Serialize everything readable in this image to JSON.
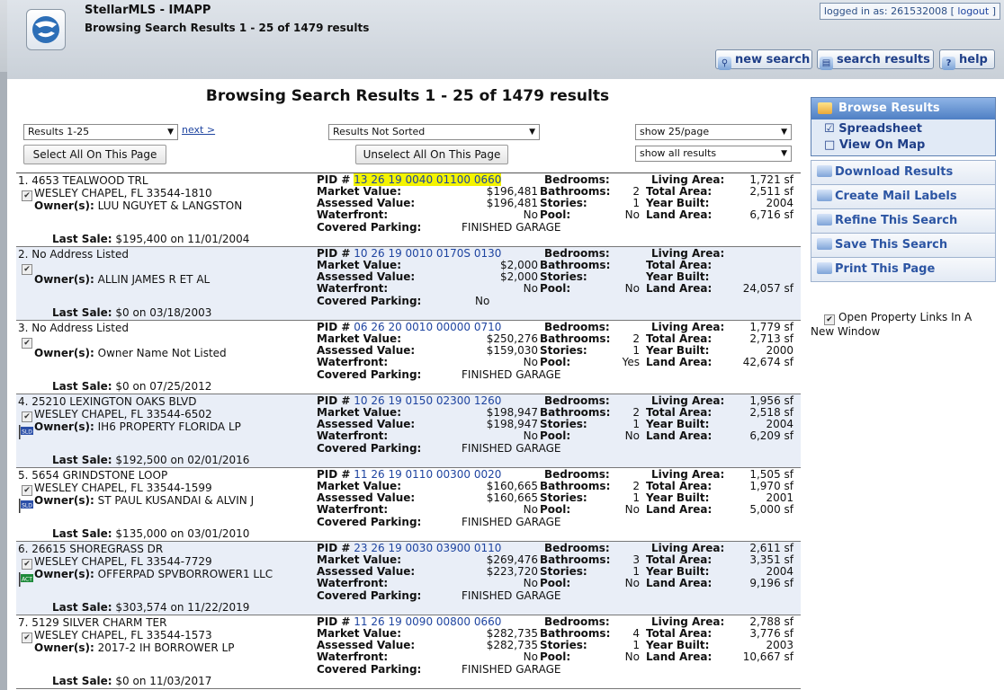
{
  "app": {
    "title": "StellarMLS - IMAPP",
    "subtitle": "Browsing Search Results 1 - 25 of 1479 results",
    "login_text": "logged in as: 261532008 [",
    "logout_label": "logout",
    "login_close": "]"
  },
  "header_buttons": {
    "new_search": "new search",
    "search_results": "search results",
    "help": "help"
  },
  "page": {
    "title": "Browsing Search Results 1 - 25 of 1479 results",
    "results_select": "Results 1-25",
    "next_link": "next >",
    "sort_select": "Results Not Sorted",
    "per_page_select": "show 25/page",
    "filter_select": "show all results",
    "select_all_btn": "Select All On This Page",
    "unselect_all_btn": "Unselect All On This Page"
  },
  "labels": {
    "pid": "PID #",
    "bedrooms": "Bedrooms:",
    "living_area": "Living Area:",
    "market_value": "Market Value:",
    "bathrooms": "Bathrooms:",
    "total_area": "Total Area:",
    "assessed_value": "Assessed Value:",
    "stories": "Stories:",
    "year_built": "Year Built:",
    "waterfront": "Waterfront:",
    "pool": "Pool:",
    "land_area": "Land Area:",
    "covered_parking": "Covered Parking:",
    "owner": "Owner(s):",
    "last_sale": "Last Sale:"
  },
  "results": [
    {
      "num": "1.",
      "address": "4653 TEALWOOD TRL",
      "city": "WESLEY CHAPEL, FL 33544-1810",
      "owner": "LUU NGUYET & LANGSTON",
      "last_sale": "$195,400 on 11/01/2004",
      "pid": "13 26 19 0040 01100 0660",
      "highlight": true,
      "flag": "",
      "market": "$196,481",
      "baths": "2",
      "assessed": "$196,481",
      "stories": "1",
      "waterfront": "No",
      "pool": "No",
      "parking": "FINISHED GARAGE",
      "living": "1,721 sf",
      "total": "2,511 sf",
      "year": "2004",
      "land": "6,716 sf"
    },
    {
      "num": "2.",
      "address": "No Address Listed",
      "city": "",
      "owner": "ALLIN JAMES R ET AL",
      "last_sale": "$0 on 03/18/2003",
      "pid": "10 26 19 0010 0170S 0130",
      "highlight": false,
      "flag": "",
      "market": "$2,000",
      "baths": "",
      "assessed": "$2,000",
      "stories": "",
      "waterfront": "No",
      "pool": "No",
      "parking": "No",
      "living": "",
      "total": "",
      "year": "",
      "land": "24,057 sf"
    },
    {
      "num": "3.",
      "address": "No Address Listed",
      "city": "",
      "owner": "Owner Name Not Listed",
      "last_sale": "$0 on 07/25/2012",
      "pid": "06 26 20 0010 00000 0710",
      "highlight": false,
      "flag": "",
      "market": "$250,276",
      "baths": "2",
      "assessed": "$159,030",
      "stories": "1",
      "waterfront": "No",
      "pool": "Yes",
      "parking": "FINISHED GARAGE",
      "living": "1,779 sf",
      "total": "2,713 sf",
      "year": "2000",
      "land": "42,674 sf"
    },
    {
      "num": "4.",
      "address": "25210 LEXINGTON OAKS BLVD",
      "city": "WESLEY CHAPEL, FL 33544-6502",
      "owner": "IH6 PROPERTY FLORIDA LP",
      "last_sale": "$192,500 on 02/01/2016",
      "pid": "10 26 19 0150 02300 1260",
      "highlight": false,
      "flag": "SLD",
      "flag_color": "#2b4fa8",
      "market": "$198,947",
      "baths": "2",
      "assessed": "$198,947",
      "stories": "1",
      "waterfront": "No",
      "pool": "No",
      "parking": "FINISHED GARAGE",
      "living": "1,956 sf",
      "total": "2,518 sf",
      "year": "2004",
      "land": "6,209 sf"
    },
    {
      "num": "5.",
      "address": "5654 GRINDSTONE LOOP",
      "city": "WESLEY CHAPEL, FL 33544-1599",
      "owner": "ST PAUL KUSANDAI & ALVIN J",
      "last_sale": "$135,000 on 03/01/2010",
      "pid": "11 26 19 0110 00300 0020",
      "highlight": false,
      "flag": "SLD",
      "flag_color": "#2b4fa8",
      "market": "$160,665",
      "baths": "2",
      "assessed": "$160,665",
      "stories": "1",
      "waterfront": "No",
      "pool": "No",
      "parking": "FINISHED GARAGE",
      "living": "1,505 sf",
      "total": "1,970 sf",
      "year": "2001",
      "land": "5,000 sf"
    },
    {
      "num": "6.",
      "address": "26615 SHOREGRASS DR",
      "city": "WESLEY CHAPEL, FL 33544-7729",
      "owner": "OFFERPAD SPVBORROWER1 LLC",
      "last_sale": "$303,574 on 11/22/2019",
      "pid": "23 26 19 0030 03900 0110",
      "highlight": false,
      "flag": "ACT",
      "flag_color": "#1d8a3a",
      "market": "$269,476",
      "baths": "3",
      "assessed": "$223,720",
      "stories": "1",
      "waterfront": "No",
      "pool": "No",
      "parking": "FINISHED GARAGE",
      "living": "2,611 sf",
      "total": "3,351 sf",
      "year": "2004",
      "land": "9,196 sf"
    },
    {
      "num": "7.",
      "address": "5129 SILVER CHARM TER",
      "city": "WESLEY CHAPEL, FL 33544-1573",
      "owner": "2017-2 IH BORROWER LP",
      "last_sale": "$0 on 11/03/2017",
      "pid": "11 26 19 0090 00800 0660",
      "highlight": false,
      "flag": "",
      "market": "$282,735",
      "baths": "4",
      "assessed": "$282,735",
      "stories": "1",
      "waterfront": "No",
      "pool": "No",
      "parking": "FINISHED GARAGE",
      "living": "2,788 sf",
      "total": "3,776 sf",
      "year": "2003",
      "land": "10,667 sf"
    }
  ],
  "sidebar": {
    "header": "Browse Results",
    "sub_items": [
      "Spreadsheet",
      "View On Map"
    ],
    "items": [
      "Download Results",
      "Create Mail Labels",
      "Refine This Search",
      "Save This Search",
      "Print This Page"
    ],
    "open_links_label": "Open Property Links In A New Window"
  },
  "colors": {
    "link": "#1e44a0",
    "highlight": "#f4f400",
    "alt_row": "#e9eef7",
    "sidebar_header": "#4e7fc4"
  }
}
